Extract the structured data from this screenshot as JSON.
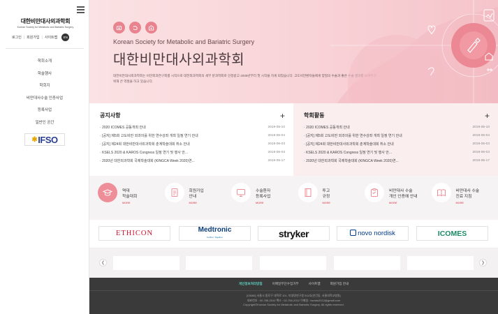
{
  "sidebar": {
    "logo_ko": "대한비만대사외과학회",
    "logo_en": "Korean Society for Metabolic and Bariatric Surgery",
    "util": {
      "login": "로그인",
      "join": "회원가입",
      "sitemap": "사이트맵",
      "lang": "EN"
    },
    "menu": [
      "학회소개",
      "학술행사",
      "학회지",
      "비만대사수술 인증사업",
      "등록사업",
      "일반인 공간"
    ],
    "ifso": "IFSO"
  },
  "hero": {
    "title_en": "Korean Society for Metabolic and Bariatric Surgery",
    "title_ko": "대한비만대사외과학회",
    "desc": "대한비만대사외과학회는 비만외과연구회를 시작으로 대한외과학회의 세부 분과학회로 인정받고 2009년부터 첫 시작을 하게 되었습니다. 고도비만환자들에게 양질의 수술과 좋은 수술 결과를 보여주기 위해 큰 역할을 하고 있습니다."
  },
  "notice": {
    "title": "공지사항",
    "items": [
      {
        "t": "2020 ICOMES 공동개최 안내",
        "d": "2019-05-10"
      },
      {
        "t": "[공지] 제5회 고도비만 외과의를 위한 연수강좌 개최 일정 연기 안내",
        "d": "2019-06-04"
      },
      {
        "t": "[공지] 제24회 대한비만대사외과학회 춘계학술대회 취소 안내",
        "d": "2019-06-03"
      },
      {
        "t": "KSELS 2020 & KAROS Congress 일정 연기 및 행사 안...",
        "d": "2019-06-03"
      },
      {
        "t": "2020년 대한외과학회 국제학술대회 (KINGCA Week 2020)연...",
        "d": "2019-05-17"
      }
    ]
  },
  "activity": {
    "title": "학회활동",
    "items": [
      {
        "t": "2020 ICOMES 공동개최 안내",
        "d": "2019-05-10"
      },
      {
        "t": "[공지] 제5회 고도비만 외과의를 위한 연수강좌 개최 일정 연기 안내",
        "d": "2019-06-04"
      },
      {
        "t": "[공지] 제24회 대한비만대사외과학회 춘계학술대회 취소 안내",
        "d": "2019-06-03"
      },
      {
        "t": "KSELS 2020 & KAROS Congress 일정 연기 및 행사 안...",
        "d": "2019-06-03"
      },
      {
        "t": "2020년 대한외과학회 국제학술대회 (KINGCA Week 2020)연...",
        "d": "2019-05-17"
      }
    ]
  },
  "quick": {
    "more": "MORE",
    "items": [
      {
        "l1": "역대",
        "l2": "학술대회",
        "icon": "graduation-cap-icon"
      },
      {
        "l1": "회원가입",
        "l2": "안내",
        "icon": "document-icon"
      },
      {
        "l1": "수술환자",
        "l2": "등록사업",
        "icon": "monitor-icon"
      },
      {
        "l1": "투고",
        "l2": "규정",
        "icon": "book-icon"
      },
      {
        "l1": "비만대사 수술",
        "l2": "개인 인증에 안내",
        "icon": "clipboard-icon"
      },
      {
        "l1": "비만대사 수술",
        "l2": "진료 지침",
        "icon": "open-book-icon"
      }
    ]
  },
  "sponsors": {
    "ethicon": "ETHICON",
    "medtronic": "Medtronic",
    "medtronic_sub": "Further, Together",
    "stryker": "stryker",
    "novo": "novo nordisk",
    "icomes": "ICOMES"
  },
  "footer": {
    "nav": [
      "개인정보처리방침",
      "이메일무단수집거부",
      "사이트맵",
      "회원가입 안내"
    ],
    "address": "[03080] 서울시 종로구 대학로 101, 의생명연구원 511호(연건동, 서울대학교병원)",
    "contact": "대표번호 : 02-765-2012     팩스 : 02-754-2012     이메일 : ksmbs2012@gmail.com",
    "copyright": "Copyright©Korean Society for Metabolic and Bariatric Surgery. All rights reserved."
  },
  "colors": {
    "accent": "#ee8e99",
    "hero_bg": "#f8d3d7",
    "footer_bg": "#3a3a3a",
    "footer_highlight": "#5ed3c4"
  }
}
